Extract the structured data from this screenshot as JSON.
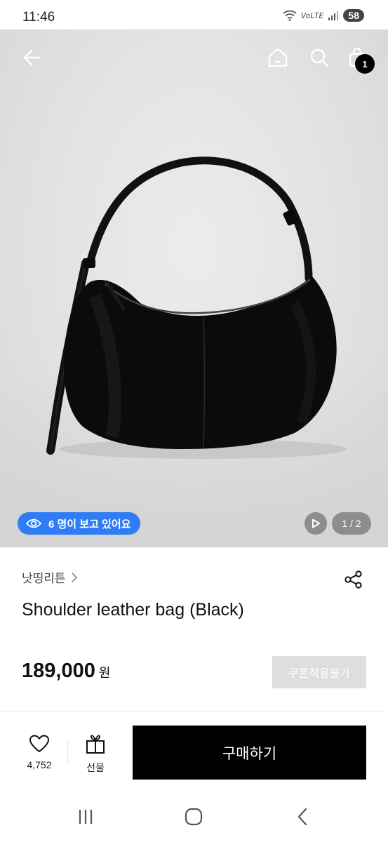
{
  "status_bar": {
    "time": "11:46",
    "network": "VoLTE",
    "battery": "58"
  },
  "header": {
    "icons": [
      "arrow-left-icon",
      "home-icon",
      "search-icon",
      "shopping-bag-icon"
    ],
    "cart_count": "1"
  },
  "gallery": {
    "viewers_text": "6 명이 보고 있어요",
    "page_indicator": "1 / 2",
    "image": "black-suede-shoulder-bag"
  },
  "product": {
    "brand": "낫띵리튼",
    "title": "Shoulder leather bag (Black)",
    "price": "189,000",
    "currency": "원",
    "coupon_label": "쿠폰적용불가"
  },
  "bottom_bar": {
    "like_count": "4,752",
    "gift_label": "선물",
    "buy_label": "구매하기"
  },
  "colors": {
    "accent_blue": "#2e7cf6",
    "buy_button": "#000000",
    "coupon_disabled": "#dedede"
  }
}
